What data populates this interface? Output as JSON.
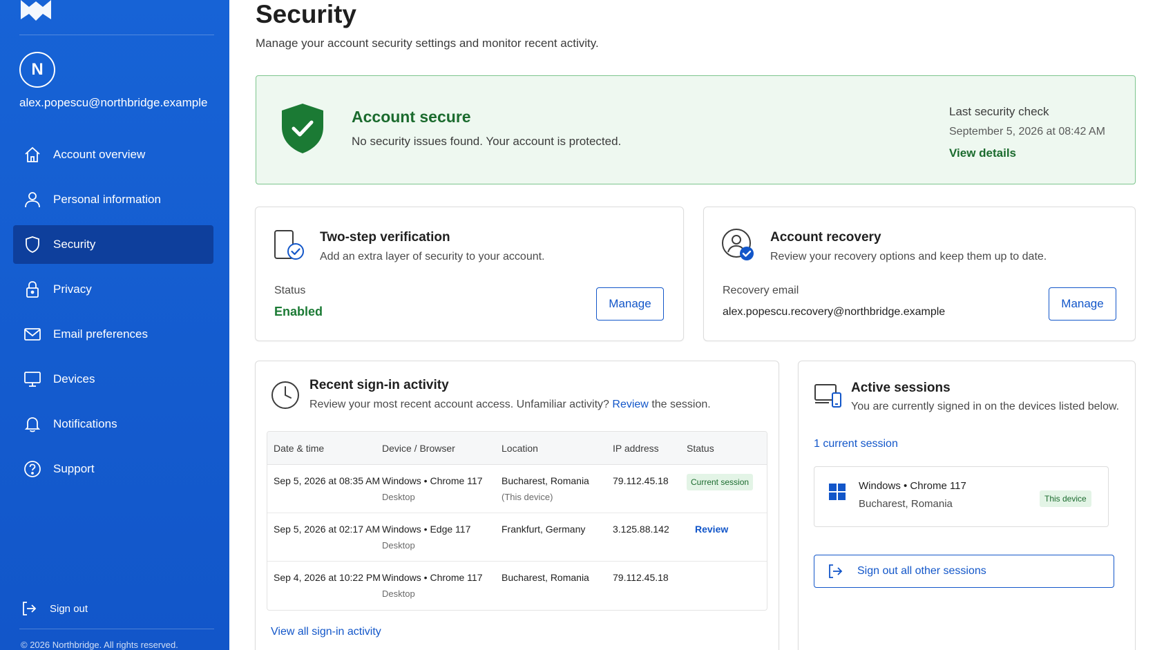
{
  "sidebar": {
    "avatar_initial": "N",
    "email": "alex.popescu@northbridge.example",
    "items": [
      {
        "label": "Account overview",
        "icon": "home-icon"
      },
      {
        "label": "Personal information",
        "icon": "person-icon"
      },
      {
        "label": "Security",
        "icon": "shield-icon",
        "active": true
      },
      {
        "label": "Privacy",
        "icon": "lock-icon"
      },
      {
        "label": "Email preferences",
        "icon": "mail-icon"
      },
      {
        "label": "Devices",
        "icon": "monitor-icon"
      },
      {
        "label": "Notifications",
        "icon": "bell-icon"
      },
      {
        "label": "Support",
        "icon": "help-icon"
      }
    ],
    "sign_out": "Sign out",
    "copyright": "© 2026 Northbridge. All rights reserved."
  },
  "header": {
    "title": "Security",
    "subtitle": "Manage your account security settings and monitor recent activity."
  },
  "banner": {
    "title": "Account secure",
    "text": "No security issues found. Your account is protected.",
    "check_label": "Last security check",
    "check_date": "September 5, 2026 at 08:42 AM",
    "check_link": "View details"
  },
  "two_step": {
    "title": "Two-step verification",
    "desc": "Add an extra layer of security to your account.",
    "status_label": "Status",
    "status_value": "Enabled",
    "button": "Manage"
  },
  "recovery": {
    "title": "Account recovery",
    "desc": "Review your recovery options and keep them up to date.",
    "email_label": "Recovery email",
    "email_value": "alex.popescu.recovery@northbridge.example",
    "button": "Manage"
  },
  "signin": {
    "title": "Recent sign-in activity",
    "desc_before": "Review your most recent account access. Unfamiliar activity?",
    "desc_link": "Review",
    "desc_after": "the session.",
    "columns": [
      "Date & time",
      "Device / Browser",
      "Location",
      "IP address",
      "Status"
    ],
    "rows": [
      {
        "date": "Sep 5, 2026 at 08:35 AM",
        "device": "Windows • Chrome 117",
        "device_sub": "Desktop",
        "location": "Bucharest, Romania",
        "location_sub": "(This device)",
        "ip": "79.112.45.18",
        "status": "Current session"
      },
      {
        "date": "Sep 5, 2026 at 02:17 AM",
        "device": "Windows • Edge 117",
        "device_sub": "Desktop",
        "location": "Frankfurt, Germany",
        "location_sub": "",
        "ip": "3.125.88.142",
        "status": "Review"
      },
      {
        "date": "Sep 4, 2026 at 10:22 PM",
        "device": "Windows • Chrome 117",
        "device_sub": "Desktop",
        "location": "Bucharest, Romania",
        "location_sub": "",
        "ip": "79.112.45.18",
        "status": ""
      }
    ],
    "view_all": "View all sign-in activity"
  },
  "sessions": {
    "title": "Active sessions",
    "desc": "You are currently signed in on the devices listed below.",
    "count": "1 current session",
    "device": "Windows • Chrome 117",
    "location": "Bucharest, Romania",
    "badge": "This device",
    "sign_out_all": "Sign out all other sessions"
  },
  "colors": {
    "sidebar": "#1256c9",
    "sidebar_active": "#0e3f9c",
    "success": "#1b6b2e",
    "link": "#1256c9"
  }
}
